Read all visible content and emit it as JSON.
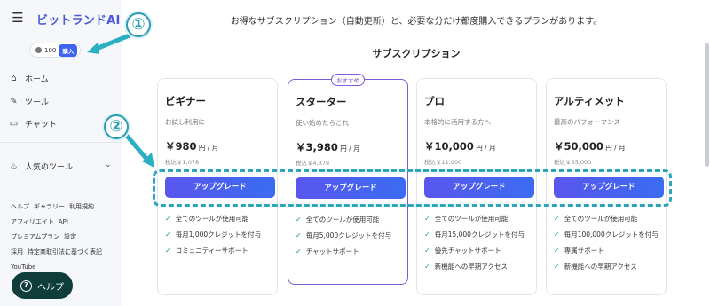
{
  "sidebar": {
    "brand": "ビットランドAI",
    "credits": "100",
    "buy_label": "購入",
    "nav": [
      {
        "label": "ホーム",
        "icon": "home-icon"
      },
      {
        "label": "ツール",
        "icon": "wrench-icon"
      },
      {
        "label": "チャット",
        "icon": "chat-icon"
      }
    ],
    "popular_tools": "人気のツール",
    "footer_links": [
      "ヘルプ",
      "ギャラリー",
      "利用規約",
      "アフィリエイト",
      "API",
      "プレミアムプラン",
      "設定",
      "採用",
      "特定商取引法に基づく表記",
      "YouTube"
    ],
    "help_label": "ヘルプ"
  },
  "annotations": {
    "one": "①",
    "two": "②"
  },
  "main": {
    "headline": "お得なサブスクリプション（自動更新）と、必要な分だけ都度購入できるプランがあります。",
    "subhead": "サブスクリプション",
    "recommended_badge": "おすすめ",
    "plans": [
      {
        "name": "ビギナー",
        "desc": "お試し利用に",
        "price": "￥980",
        "per": " 円 / 月",
        "tax": "税込￥1,078",
        "button": "アップグレード",
        "features": [
          "全てのツールが使用可能",
          "毎月1,000クレジットを付与",
          "コミュニティーサポート"
        ]
      },
      {
        "name": "スターター",
        "desc": "使い始めたらこれ",
        "price": "￥3,980",
        "per": " 円 / 月",
        "tax": "税込￥4,378",
        "button": "アップグレード",
        "features": [
          "全てのツールが使用可能",
          "毎月5,000クレジットを付与",
          "チャットサポート"
        ]
      },
      {
        "name": "プロ",
        "desc": "本格的に活用する方へ",
        "price": "￥10,000",
        "per": " 円 / 月",
        "tax": "税込￥11,000",
        "button": "アップグレード",
        "features": [
          "全てのツールが使用可能",
          "毎月15,000クレジットを付与",
          "優先チャットサポート",
          "新機能への早期アクセス"
        ]
      },
      {
        "name": "アルティメット",
        "desc": "最高のパフォーマンス",
        "price": "￥50,000",
        "per": " 円 / 月",
        "tax": "税込￥55,000",
        "button": "アップグレード",
        "features": [
          "全てのツールが使用可能",
          "毎月100,000クレジットを付与",
          "専属サポート",
          "新機能への早期アクセス"
        ]
      }
    ]
  },
  "colors": {
    "accent": "#3d63f0",
    "featured_border": "#7c5cd6",
    "annotation": "#2aa7b9",
    "check": "#2aa64a"
  }
}
